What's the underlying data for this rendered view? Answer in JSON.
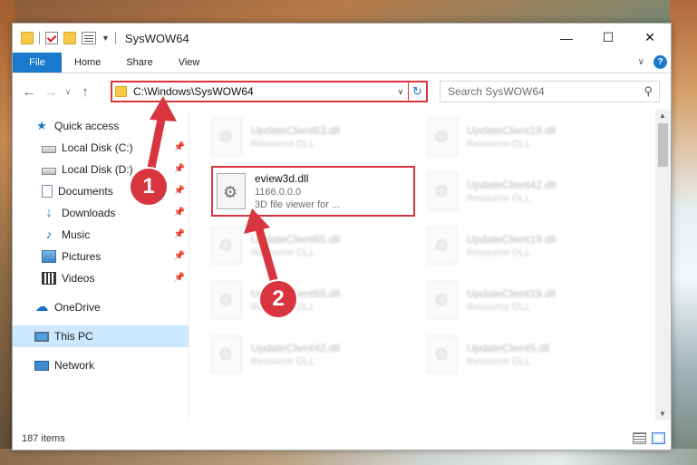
{
  "window": {
    "title": "SysWOW64",
    "controls": {
      "minimize": "—",
      "maximize": "☐",
      "close": "✕"
    }
  },
  "ribbon": {
    "tabs": [
      {
        "label": "File"
      },
      {
        "label": "Home"
      },
      {
        "label": "Share"
      },
      {
        "label": "View"
      }
    ],
    "help_label": "?"
  },
  "address": {
    "path": "C:\\Windows\\SysWOW64",
    "search_placeholder": "Search SysWOW64"
  },
  "sidebar": {
    "quick_access": "Quick access",
    "pinned": [
      {
        "label": "Local Disk (C:)",
        "icon": "drive-icon"
      },
      {
        "label": "Local Disk (D:)",
        "icon": "drive-icon"
      },
      {
        "label": "Documents",
        "icon": "documents-icon"
      },
      {
        "label": "Downloads",
        "icon": "downloads-icon"
      },
      {
        "label": "Music",
        "icon": "music-icon"
      },
      {
        "label": "Pictures",
        "icon": "pictures-icon"
      },
      {
        "label": "Videos",
        "icon": "videos-icon"
      }
    ],
    "onedrive": "OneDrive",
    "this_pc": "This PC",
    "network": "Network"
  },
  "files": {
    "background_tiles": [
      {
        "name": "UpdateClient63.dll",
        "type": "Resource DLL"
      },
      {
        "name": "UpdateClient19.dll",
        "type": "Resource DLL"
      },
      {
        "name": "UpdateClient42.dll",
        "type": "Resource DLL"
      },
      {
        "name": "UpdateClient65.dll",
        "type": "Resource DLL"
      },
      {
        "name": "UpdateClient19.dll",
        "type": "Resource DLL"
      },
      {
        "name": "UpdateClient65.dll",
        "type": "Resource DLL"
      },
      {
        "name": "UpdateClient19.dll",
        "type": "Resource DLL"
      },
      {
        "name": "UpdateClient42.dll",
        "type": "Resource DLL"
      },
      {
        "name": "UpdateClient5.dll",
        "type": "Resource DLL"
      }
    ],
    "highlighted": {
      "name": "eview3d.dll",
      "version": "1166.0.0.0",
      "description": "3D file viewer for ..."
    }
  },
  "status": {
    "item_count": "187 items"
  },
  "annotations": {
    "badge_1": "1",
    "badge_2": "2",
    "color": "#d9353f"
  }
}
